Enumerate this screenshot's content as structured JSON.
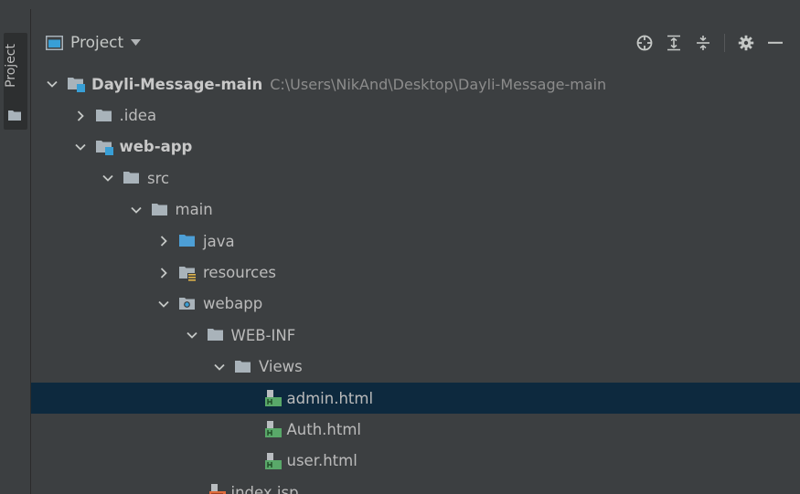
{
  "panel": {
    "view_title": "Project",
    "side_tab_label": "Project"
  },
  "header_actions": [
    {
      "name": "locate-icon"
    },
    {
      "name": "expand-all-icon"
    },
    {
      "name": "collapse-all-icon"
    },
    {
      "name": "gear-icon"
    },
    {
      "name": "minimize-icon"
    }
  ],
  "tree": [
    {
      "label": "Dayli-Message-main",
      "path": "C:\\Users\\NikAnd\\Desktop\\Dayli-Message-main",
      "depth": 0,
      "expanded": true,
      "icon": "module-folder-icon",
      "bold": true
    },
    {
      "label": ".idea",
      "depth": 1,
      "expanded": false,
      "icon": "folder-icon"
    },
    {
      "label": "web-app",
      "depth": 1,
      "expanded": true,
      "icon": "module-folder-icon",
      "bold": true
    },
    {
      "label": "src",
      "depth": 2,
      "expanded": true,
      "icon": "folder-icon"
    },
    {
      "label": "main",
      "depth": 3,
      "expanded": true,
      "icon": "folder-icon"
    },
    {
      "label": "java",
      "depth": 4,
      "expanded": false,
      "icon": "source-folder-icon"
    },
    {
      "label": "resources",
      "depth": 4,
      "expanded": false,
      "icon": "resources-folder-icon"
    },
    {
      "label": "webapp",
      "depth": 4,
      "expanded": true,
      "icon": "web-folder-icon"
    },
    {
      "label": "WEB-INF",
      "depth": 5,
      "expanded": true,
      "icon": "folder-icon"
    },
    {
      "label": "Views",
      "depth": 6,
      "expanded": true,
      "icon": "folder-icon"
    },
    {
      "label": "admin.html",
      "depth": 7,
      "leaf": true,
      "icon": "html-file-icon",
      "selected": true
    },
    {
      "label": "Auth.html",
      "depth": 7,
      "leaf": true,
      "icon": "html-file-icon"
    },
    {
      "label": "user.html",
      "depth": 7,
      "leaf": true,
      "icon": "html-file-icon"
    },
    {
      "label": "index.jsp",
      "depth": 5,
      "leaf": true,
      "icon": "jsp-file-icon"
    }
  ],
  "colors": {
    "background": "#3c3f41",
    "selection": "#0d293e",
    "folder": "#a9b3ba",
    "module_accent": "#389fd6",
    "source_folder": "#4d9fd6",
    "html_icon": "#59a869",
    "jsp_icon": "#e06c3c"
  }
}
